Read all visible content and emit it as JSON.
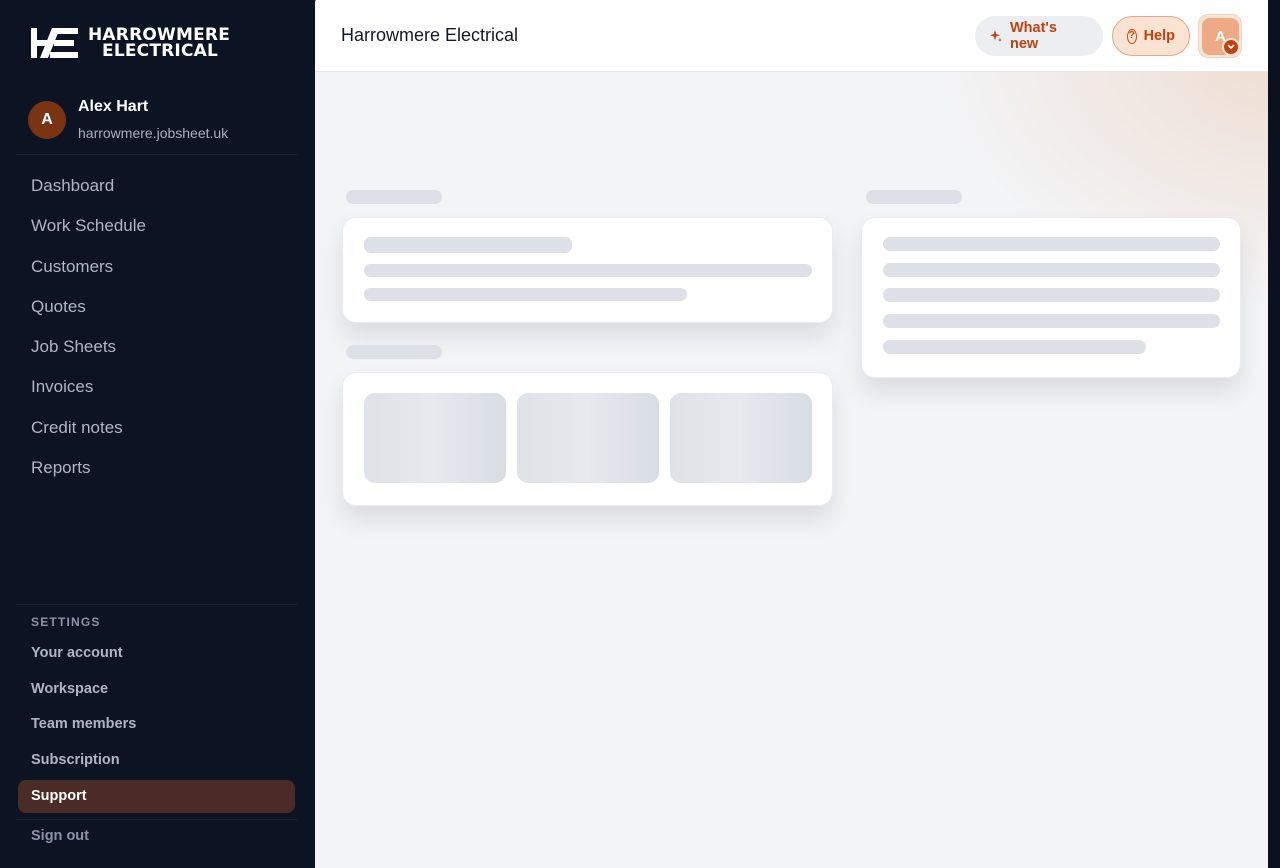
{
  "brand": {
    "line1": "HARROWMERE",
    "line2": "ELECTRICAL"
  },
  "user": {
    "initial": "A",
    "name": "Alex Hart",
    "domain": "harrowmere.jobsheet.uk"
  },
  "nav": {
    "items": [
      {
        "label": "Dashboard"
      },
      {
        "label": "Work Schedule"
      },
      {
        "label": "Customers"
      },
      {
        "label": "Quotes"
      },
      {
        "label": "Job Sheets"
      },
      {
        "label": "Invoices"
      },
      {
        "label": "Credit notes"
      },
      {
        "label": "Reports"
      }
    ]
  },
  "settings": {
    "title": "SETTINGS",
    "items": [
      {
        "label": "Your account"
      },
      {
        "label": "Workspace"
      },
      {
        "label": "Team members"
      },
      {
        "label": "Subscription"
      },
      {
        "label": "Support",
        "active": true
      }
    ],
    "signout": "Sign out"
  },
  "header": {
    "title": "Harrowmere Electrical",
    "whats_new": "What's new",
    "help": "Help",
    "help_icon_glyph": "?",
    "avatar_initial": "A"
  },
  "icons": {
    "whats_new": "sparkle-icon",
    "help": "help-circle-icon",
    "avatar_badge": "chevron-down-icon"
  },
  "colors": {
    "sidebar_bg": "#0c1424",
    "accent": "#c2410c",
    "active_item_bg": "#4a2b25"
  }
}
